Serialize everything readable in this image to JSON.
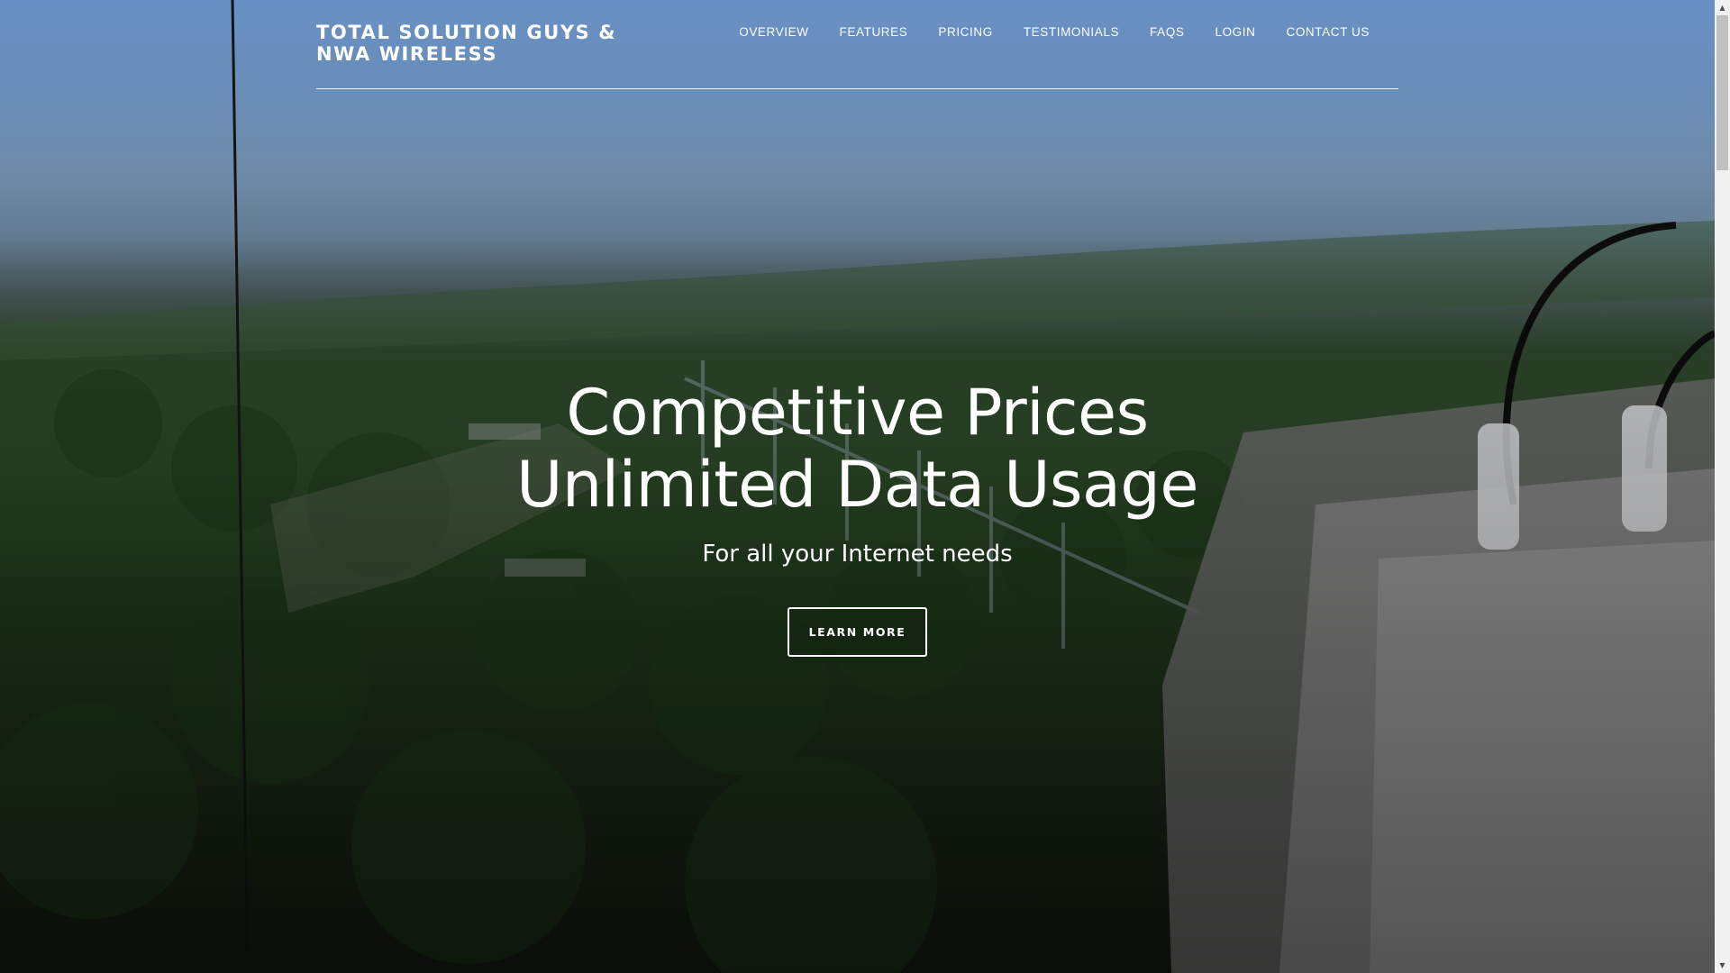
{
  "header": {
    "brand_line1": "TOTAL SOLUTION GUYS &",
    "brand_line2": "NWA WIRELESS",
    "nav": [
      {
        "label": "OVERVIEW"
      },
      {
        "label": "FEATURES"
      },
      {
        "label": "PRICING"
      },
      {
        "label": "TESTIMONIALS"
      },
      {
        "label": "FAQS"
      },
      {
        "label": "LOGIN"
      },
      {
        "label": "CONTACT US"
      }
    ]
  },
  "hero": {
    "headline_line1": "Competitive Prices",
    "headline_line2": "Unlimited Data Usage",
    "subheadline": "For all your Internet needs",
    "cta_label": "LEARN MORE",
    "background_image": "aerial-forest-tower-antenna"
  },
  "scrollbar": {
    "up_icon": "scroll-up-arrow-icon",
    "down_icon": "scroll-down-arrow-icon"
  },
  "colors": {
    "text": "#ffffff",
    "sky": "#6790c4",
    "forest": "#2c4a27"
  }
}
